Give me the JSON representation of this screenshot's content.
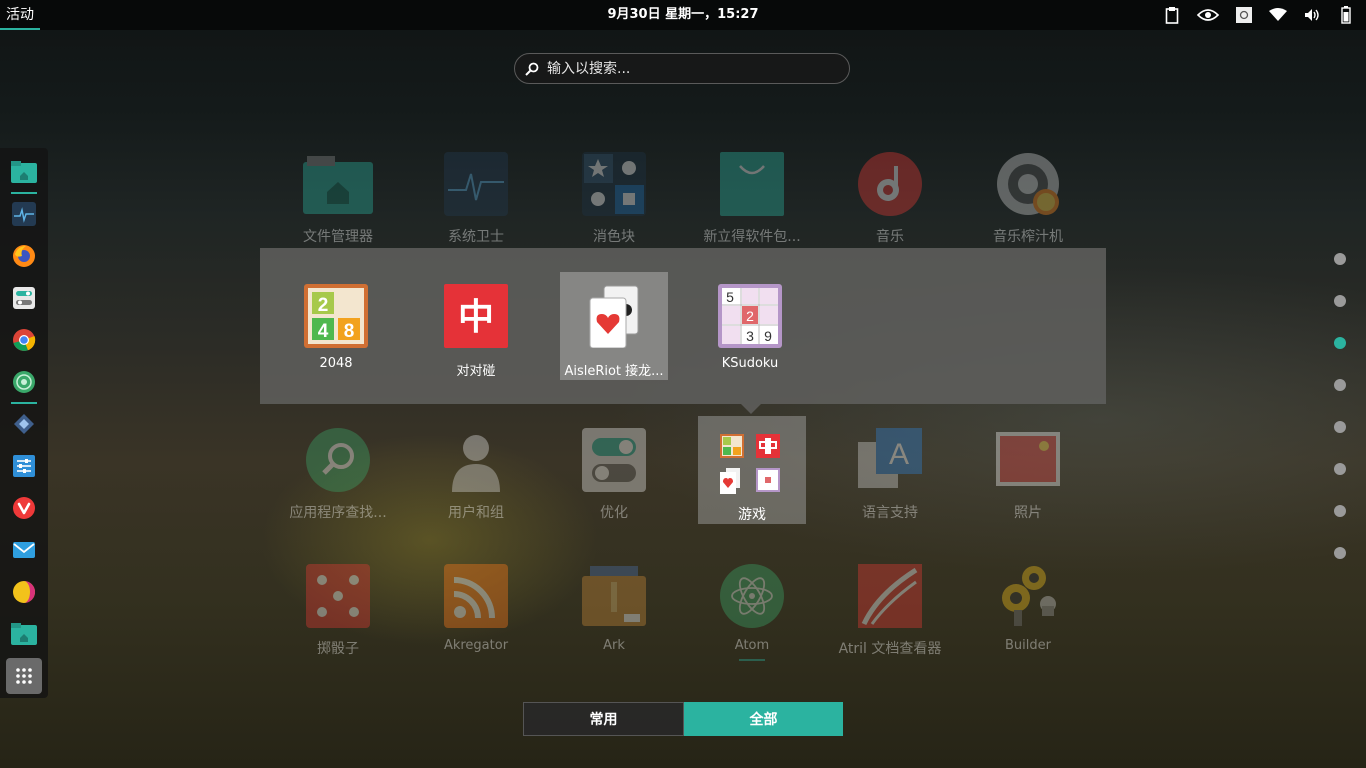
{
  "topbar": {
    "activities": "活动",
    "clock": "9月30日 星期一，15:27",
    "tray_icons": [
      "clipboard-icon",
      "nvidia-icon",
      "screenshot-icon",
      "wifi-icon",
      "volume-icon",
      "battery-icon"
    ]
  },
  "search": {
    "placeholder": "输入以搜索..."
  },
  "dock": {
    "items": [
      "files",
      "system-monitor",
      "firefox",
      "settings",
      "chrome",
      "network",
      "kdeconnect",
      "tweaks",
      "vivaldi",
      "mail",
      "palette",
      "files-2",
      "show-apps"
    ]
  },
  "apps": {
    "row1": [
      "文件管理器",
      "系统卫士",
      "消色块",
      "新立得软件包...",
      "音乐",
      "音乐榨汁机"
    ],
    "row3": [
      "应用程序查找...",
      "用户和组",
      "优化",
      "游戏",
      "语言支持",
      "照片"
    ],
    "row4": [
      "掷骰子",
      "Akregator",
      "Ark",
      "Atom",
      "Atril 文档查看器",
      "Builder"
    ]
  },
  "folder": {
    "name": "游戏",
    "apps": [
      {
        "label": "2048",
        "tiles": [
          "2",
          "4",
          "8"
        ]
      },
      {
        "label": "对对碰",
        "glyph": "中"
      },
      {
        "label": "AisleRiot 接龙..."
      },
      {
        "label": "KSudoku",
        "cells": [
          "5",
          "2",
          "3",
          "9"
        ]
      }
    ]
  },
  "pages": {
    "count": 8,
    "current": 3
  },
  "switcher": {
    "common": "常用",
    "all": "全部",
    "selected": "全部"
  },
  "colors": {
    "accent": "#2bb3a0"
  }
}
